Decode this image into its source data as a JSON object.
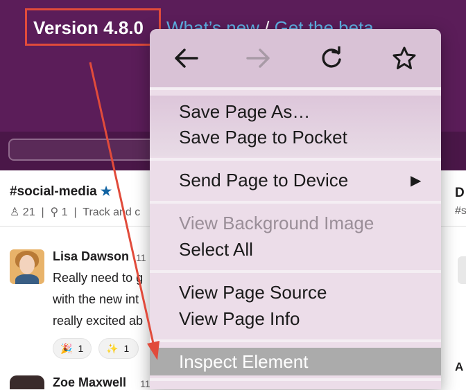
{
  "banner": {
    "version_label": "Version 4.8.0",
    "link_whats_new": "What’s new",
    "link_separator": "/",
    "link_get_beta": "Get the beta"
  },
  "channel": {
    "name": "#social-media",
    "member_count": "21",
    "pinned_count": "1",
    "topic_fragment": "Track and c"
  },
  "messages": [
    {
      "author": "Lisa Dawson",
      "time_fragment": "11",
      "lines": [
        "Really need to g",
        "with the new int",
        "really excited ab"
      ],
      "reactions": [
        {
          "emoji": "🎉",
          "count": "1"
        },
        {
          "emoji": "✨",
          "count": "1"
        }
      ]
    },
    {
      "author": "Zoe Maxwell",
      "time_fragment": "11"
    }
  ],
  "right_fragments": {
    "title_initial": "D",
    "hash": "#s",
    "bottom_initial": "A"
  },
  "menu": {
    "nav_icons": [
      "back-arrow-icon",
      "forward-arrow-icon",
      "reload-icon",
      "bookmark-star-icon"
    ],
    "items": {
      "save_page_as": "Save Page As…",
      "save_to_pocket": "Save Page to Pocket",
      "send_to_device": "Send Page to Device",
      "view_background_image": "View Background Image",
      "select_all": "Select All",
      "view_page_source": "View Page Source",
      "view_page_info": "View Page Info",
      "inspect_element": "Inspect Element"
    }
  },
  "colors": {
    "banner_purple": "#5b1d59",
    "link_blue": "#5fb3e6",
    "annotation_red": "#e14b3b",
    "menu_bg": "#ecdde9",
    "menu_highlight": "#ababab"
  }
}
